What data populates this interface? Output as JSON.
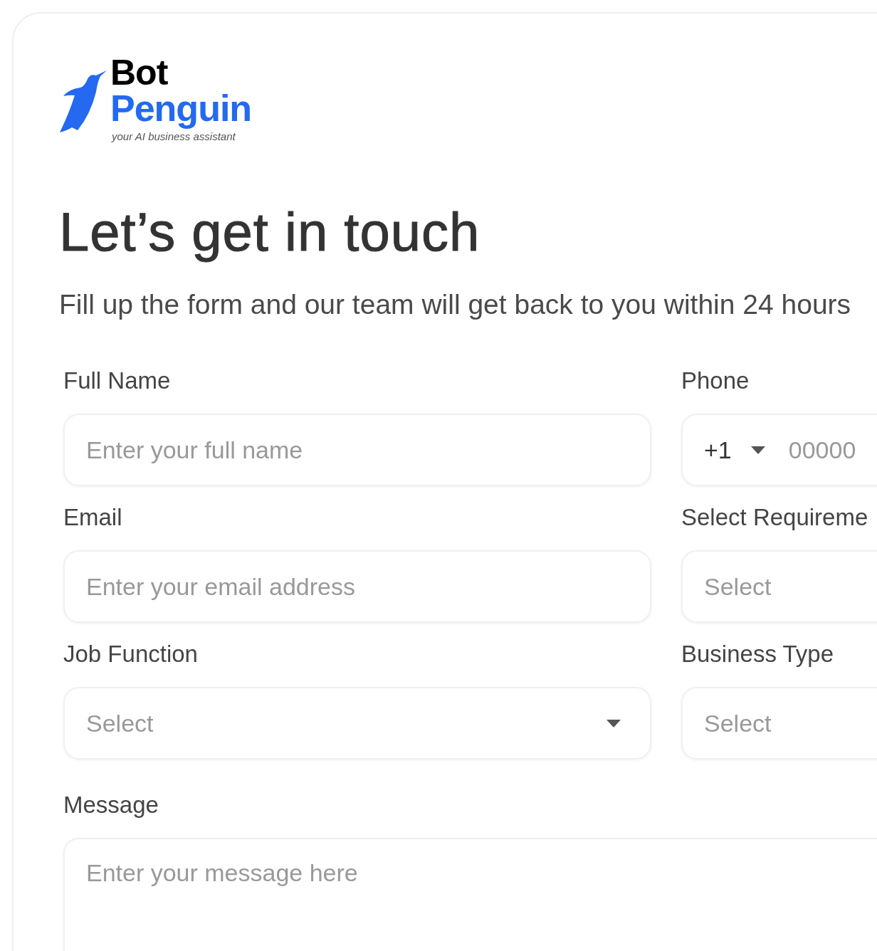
{
  "logo": {
    "line_1": "Bot",
    "line_2": "Penguin",
    "tagline": "your AI business assistant"
  },
  "title": "Let’s get in touch",
  "subtitle": "Fill up the form and our team will get back to you within 24 hours",
  "fields": [
    {
      "kind": "text",
      "label": "Full Name",
      "placeholder": "Enter your full name"
    },
    {
      "kind": "phone",
      "label": "Phone",
      "code": "+1",
      "placeholder": "00000"
    },
    {
      "kind": "text",
      "label": "Email",
      "placeholder": "Enter your email address"
    },
    {
      "kind": "select",
      "label": "Select Requireme",
      "placeholder": "Select",
      "caret": false
    },
    {
      "kind": "select",
      "label": "Job Function",
      "placeholder": "Select",
      "caret": true
    },
    {
      "kind": "select",
      "label": "Business Type",
      "placeholder": "Select",
      "caret": false
    }
  ],
  "message": {
    "label": "Message",
    "placeholder": "Enter your message here"
  }
}
